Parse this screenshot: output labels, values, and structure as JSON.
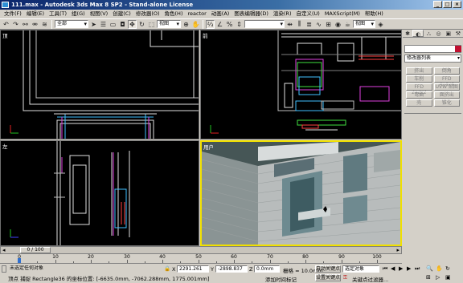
{
  "window": {
    "title": "111.max - Autodesk 3ds Max 8 SP2 - Stand-alone License"
  },
  "menu": [
    "文件(F)",
    "编辑(E)",
    "工具(T)",
    "组(G)",
    "视图(V)",
    "创建(C)",
    "修改器(O)",
    "角色(H)",
    "reactor",
    "动画(A)",
    "图表编辑器(D)",
    "渲染(R)",
    "自定义(U)",
    "MAXScript(M)",
    "帮助(H)"
  ],
  "toolbar": {
    "filter": "全部",
    "coord": "视图",
    "named_sel": "视图"
  },
  "viewports": {
    "top": "顶",
    "front": "前",
    "left": "左",
    "persp": "用户"
  },
  "command_panel": {
    "modifier_list": "修改器列表",
    "buttons": [
      "挤出",
      "倒角",
      "车削",
      "FFD 4x4x4",
      "FFD 2x2x2",
      "UVW 贴图",
      "弯曲",
      "面挤出",
      "壳",
      "锥化"
    ]
  },
  "timeslider": {
    "label": "0 / 100"
  },
  "ruler": {
    "ticks": [
      "0",
      "10",
      "20",
      "30",
      "40",
      "50",
      "60",
      "70",
      "80",
      "90",
      "100"
    ]
  },
  "status": {
    "selection": "未选定任何对象",
    "prompt": "顶点 捕捉 Rectangle36 的坐标位置: [-6635.0mm, -7062.288mm, 1775.001mm]",
    "x": "2291.261",
    "y": "-2898.837",
    "z": "0.0mm",
    "grid": "栅格 = 10.0mm",
    "add_time_tag": "添加时间标记",
    "auto_key": "自动关键点",
    "set_key": "设置关键点",
    "selected": "选定对象",
    "key_filters": "关键点过滤器..."
  }
}
